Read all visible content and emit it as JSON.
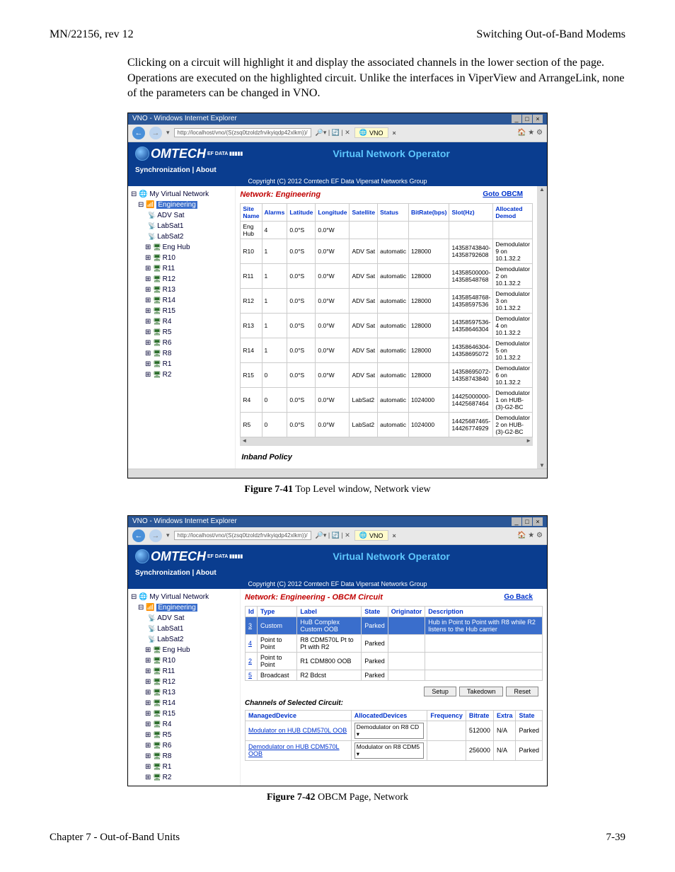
{
  "header": {
    "left": "MN/22156, rev 12",
    "right": "Switching Out-of-Band Modems"
  },
  "intro": "Clicking on a circuit will highlight it and display the associated channels in the lower section of the page. Operations are executed on the highlighted circuit. Unlike the interfaces in ViperView and ArrangeLink, none of the parameters can be changed in VNO.",
  "browser": {
    "title": "VNO - Windows Internet Explorer",
    "url": "http://localhost/vno/(S(zsq0tzoldzfrvikyiqdp42xlkm))/",
    "tab": "VNO",
    "banner_title": "Virtual Network Operator",
    "menu": "Synchronization   |   About",
    "copyright": "Copyright (C) 2012     Comtech EF Data Vipersat Networks Group"
  },
  "tree1": {
    "root": "My Virtual Network",
    "hl": "Engineering",
    "items": [
      "ADV Sat",
      "LabSat1",
      "LabSat2",
      "Eng Hub",
      "R10",
      "R11",
      "R12",
      "R13",
      "R14",
      "R15",
      "R4",
      "R5",
      "R6",
      "R8",
      "R1",
      "R2"
    ]
  },
  "fig1": {
    "net_title": "Network: Engineering",
    "goto": "Goto OBCM",
    "cols": [
      "Site Name",
      "Alarms",
      "Latitude",
      "Longitude",
      "Satellite",
      "Status",
      "BitRate(bps)",
      "Slot(Hz)",
      "Allocated Demod"
    ],
    "rows": [
      [
        "Eng Hub",
        "4",
        "0.0°S",
        "0.0°W",
        "",
        "",
        "",
        "",
        ""
      ],
      [
        "R10",
        "1",
        "0.0°S",
        "0.0°W",
        "ADV Sat",
        "automatic",
        "128000",
        "14358743840-14358792608",
        "Demodulator 9 on 10.1.32.2"
      ],
      [
        "R11",
        "1",
        "0.0°S",
        "0.0°W",
        "ADV Sat",
        "automatic",
        "128000",
        "14358500000-14358548768",
        "Demodulator 2 on 10.1.32.2"
      ],
      [
        "R12",
        "1",
        "0.0°S",
        "0.0°W",
        "ADV Sat",
        "automatic",
        "128000",
        "14358548768-14358597536",
        "Demodulator 3 on 10.1.32.2"
      ],
      [
        "R13",
        "1",
        "0.0°S",
        "0.0°W",
        "ADV Sat",
        "automatic",
        "128000",
        "14358597536-14358646304",
        "Demodulator 4 on 10.1.32.2"
      ],
      [
        "R14",
        "1",
        "0.0°S",
        "0.0°W",
        "ADV Sat",
        "automatic",
        "128000",
        "14358646304-14358695072",
        "Demodulator 5 on 10.1.32.2"
      ],
      [
        "R15",
        "0",
        "0.0°S",
        "0.0°W",
        "ADV Sat",
        "automatic",
        "128000",
        "14358695072-14358743840",
        "Demodulator 6 on 10.1.32.2"
      ],
      [
        "R4",
        "0",
        "0.0°S",
        "0.0°W",
        "LabSat2",
        "automatic",
        "1024000",
        "14425000000-14425687464",
        "Demodulator 1 on HUB-(3)-G2-BC"
      ],
      [
        "R5",
        "0",
        "0.0°S",
        "0.0°W",
        "LabSat2",
        "automatic",
        "1024000",
        "14425687465-14426774929",
        "Demodulator 2 on HUB-(3)-G2-BC"
      ]
    ],
    "inband": "Inband Policy",
    "caption_b": "Figure 7-41",
    "caption_t": "   Top Level window, Network view"
  },
  "fig2": {
    "net_title": "Network: Engineering - OBCM Circuit",
    "goback": "Go Back",
    "cols": [
      "Id",
      "Type",
      "Label",
      "State",
      "Originator",
      "Description"
    ],
    "rows": [
      {
        "id": "3",
        "type": "Custom",
        "label": "HuB Complex Custom OOB",
        "state": "Parked",
        "orig": "",
        "desc": "Hub in Point to Point with R8 while R2 listens to the Hub carrier",
        "hl": true
      },
      {
        "id": "4",
        "type": "Point to Point",
        "label": "R8 CDM570L Pt to Pt with R2",
        "state": "Parked",
        "orig": "",
        "desc": ""
      },
      {
        "id": "2",
        "type": "Point to Point",
        "label": "R1 CDM800 OOB",
        "state": "Parked",
        "orig": "",
        "desc": ""
      },
      {
        "id": "5",
        "type": "Broadcast",
        "label": "R2 Bdcst",
        "state": "Parked",
        "orig": "",
        "desc": ""
      }
    ],
    "buttons": [
      "Setup",
      "Takedown",
      "Reset"
    ],
    "channels_title": "Channels of Selected Circuit:",
    "chan_cols": [
      "ManagedDevice",
      "AllocatedDevices",
      "Frequency",
      "Bitrate",
      "Extra",
      "State"
    ],
    "chan_rows": [
      {
        "dev": "Modulator on HUB CDM570L OOB",
        "alloc": "Demodulator on R8 CD",
        "freq": "",
        "bitrate": "512000",
        "extra": "N/A",
        "state": "Parked"
      },
      {
        "dev": "Demodulator on HUB CDM570L OOB",
        "alloc": "Modulator on R8 CDM5",
        "freq": "",
        "bitrate": "256000",
        "extra": "N/A",
        "state": "Parked"
      }
    ],
    "caption_b": "Figure 7-42",
    "caption_t": "   OBCM Page, Network"
  },
  "footer": {
    "left": "Chapter 7 - Out-of-Band Units",
    "right": "7-39"
  }
}
